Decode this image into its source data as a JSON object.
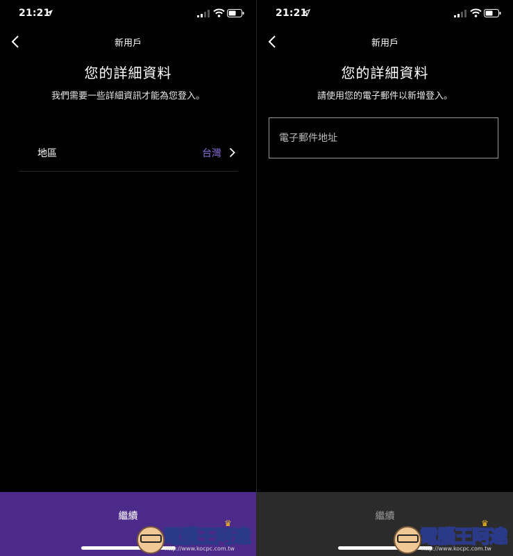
{
  "left": {
    "status": {
      "time": "21:21"
    },
    "nav": {
      "title": "新用戶"
    },
    "heading": "您的詳細資料",
    "subtitle": "我們需要一些詳細資訊才能為您登入。",
    "region": {
      "label": "地區",
      "value": "台灣"
    },
    "continue_label": "繼續"
  },
  "right": {
    "status": {
      "time": "21:21"
    },
    "nav": {
      "title": "新用戶"
    },
    "heading": "您的詳細資料",
    "subtitle": "請使用您的電子郵件以新增登入。",
    "email": {
      "placeholder": "電子郵件地址",
      "value": ""
    },
    "continue_label": "繼續"
  },
  "watermark": {
    "text": "電腦王阿達",
    "url": "http://www.kocpc.com.tw"
  },
  "colors": {
    "background": "#000000",
    "accent_purple": "#4b2a8a",
    "region_value": "#8a72e0",
    "disabled_button": "#2b2b2b",
    "disabled_text": "#9a9a9a"
  }
}
